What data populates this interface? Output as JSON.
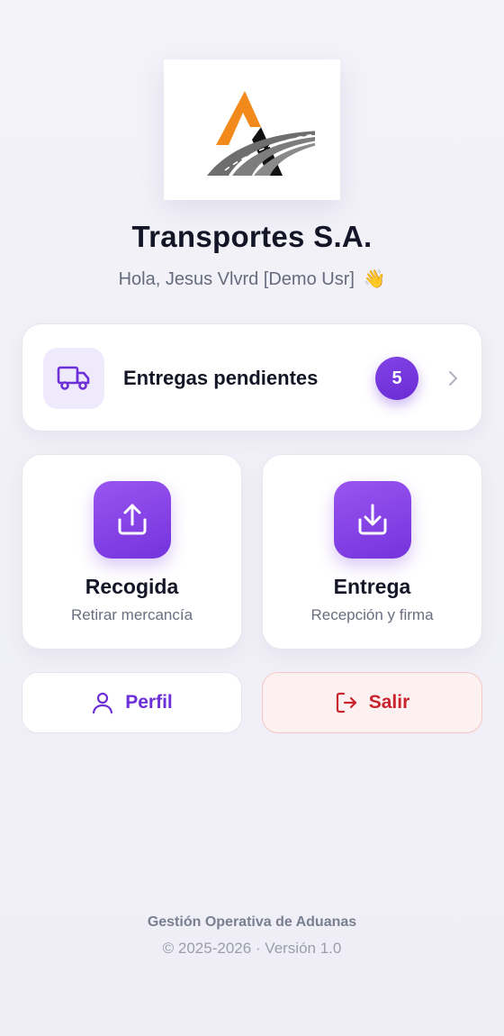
{
  "header": {
    "company_name": "Transportes S.A.",
    "greeting": "Hola, Jesus Vlvrd [Demo Usr]",
    "greeting_emoji": "👋"
  },
  "pending_card": {
    "label": "Entregas pendientes",
    "count": "5",
    "icon": "truck-icon"
  },
  "actions": [
    {
      "title": "Recogida",
      "subtitle": "Retirar mercancía",
      "icon": "upload-icon"
    },
    {
      "title": "Entrega",
      "subtitle": "Recepción y firma",
      "icon": "download-icon"
    }
  ],
  "buttons": {
    "profile_label": "Perfil",
    "logout_label": "Salir"
  },
  "footer": {
    "line1": "Gestión Operativa de Aduanas",
    "line2": "© 2025-2026 · Versión 1.0"
  },
  "colors": {
    "accent": "#7433dc",
    "danger": "#c9242e",
    "logo_orange": "#f28a1b",
    "logo_gray": "#707070"
  }
}
